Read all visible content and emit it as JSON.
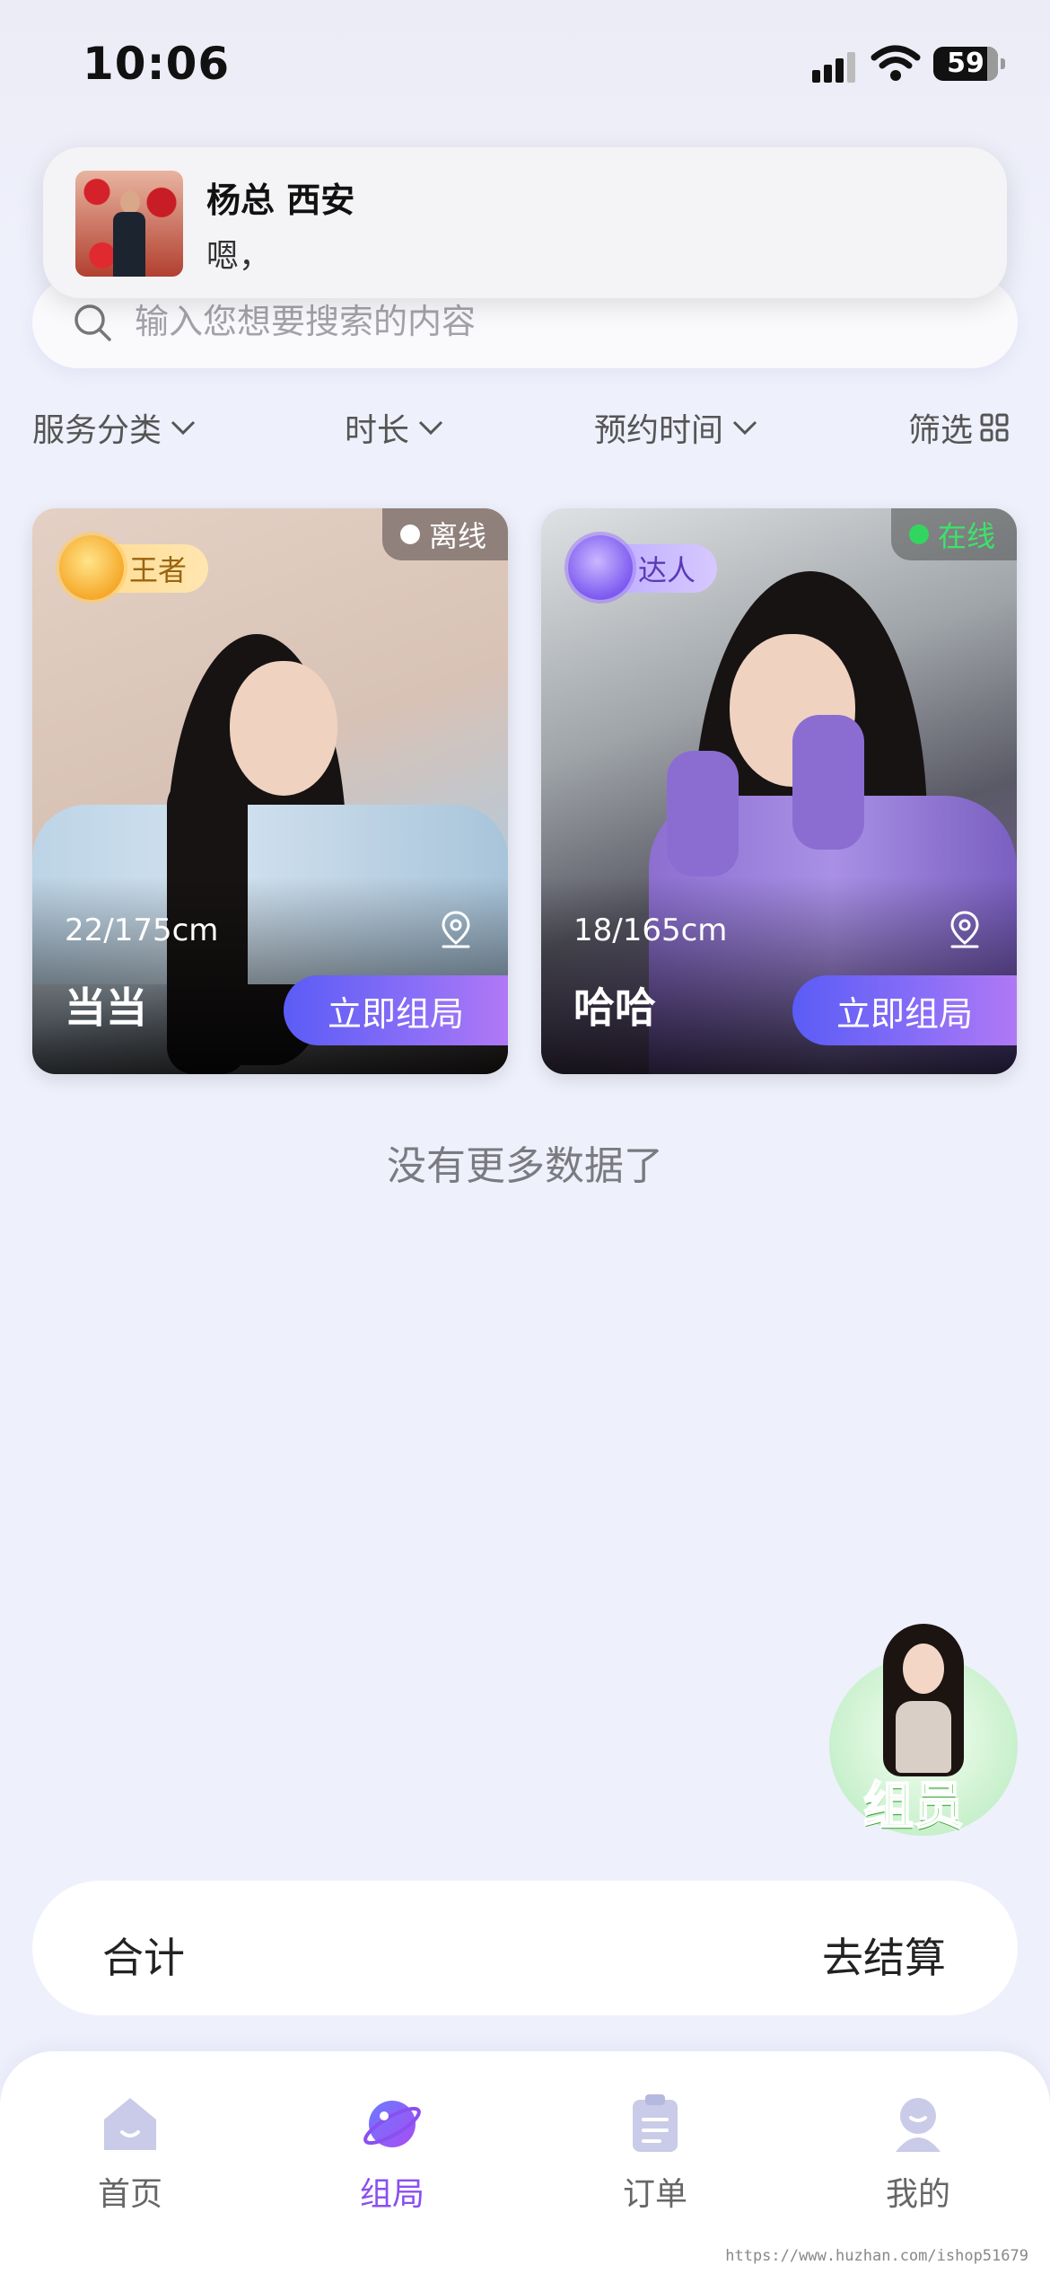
{
  "status_bar": {
    "time": "10:06",
    "battery": "59"
  },
  "notification": {
    "sender": "杨总  西安",
    "message": "嗯，"
  },
  "search": {
    "placeholder": "输入您想要搜索的内容"
  },
  "filters": [
    {
      "label": "服务分类"
    },
    {
      "label": "时长"
    },
    {
      "label": "预约时间"
    },
    {
      "label": "筛选"
    }
  ],
  "cards": [
    {
      "name": "当当",
      "meta": "22/175cm",
      "rank": "王者",
      "status": "离线",
      "button": "立即组局"
    },
    {
      "name": "哈哈",
      "meta": "18/165cm",
      "rank": "达人",
      "status": "在线",
      "button": "立即组局"
    }
  ],
  "list_end": "没有更多数据了",
  "floating_badge": {
    "label": "组员"
  },
  "cart": {
    "total_label": "合计",
    "checkout_label": "去结算"
  },
  "tabs": [
    {
      "label": "首页",
      "icon": "home-icon"
    },
    {
      "label": "组局",
      "icon": "planet-icon",
      "active": true
    },
    {
      "label": "订单",
      "icon": "clipboard-icon"
    },
    {
      "label": "我的",
      "icon": "user-icon"
    }
  ],
  "colors": {
    "accent": "#8a4ff0",
    "online": "#32d65f",
    "button_start": "#5b5cf6",
    "button_end": "#b078f5"
  },
  "watermark": "https://www.huzhan.com/ishop51679"
}
